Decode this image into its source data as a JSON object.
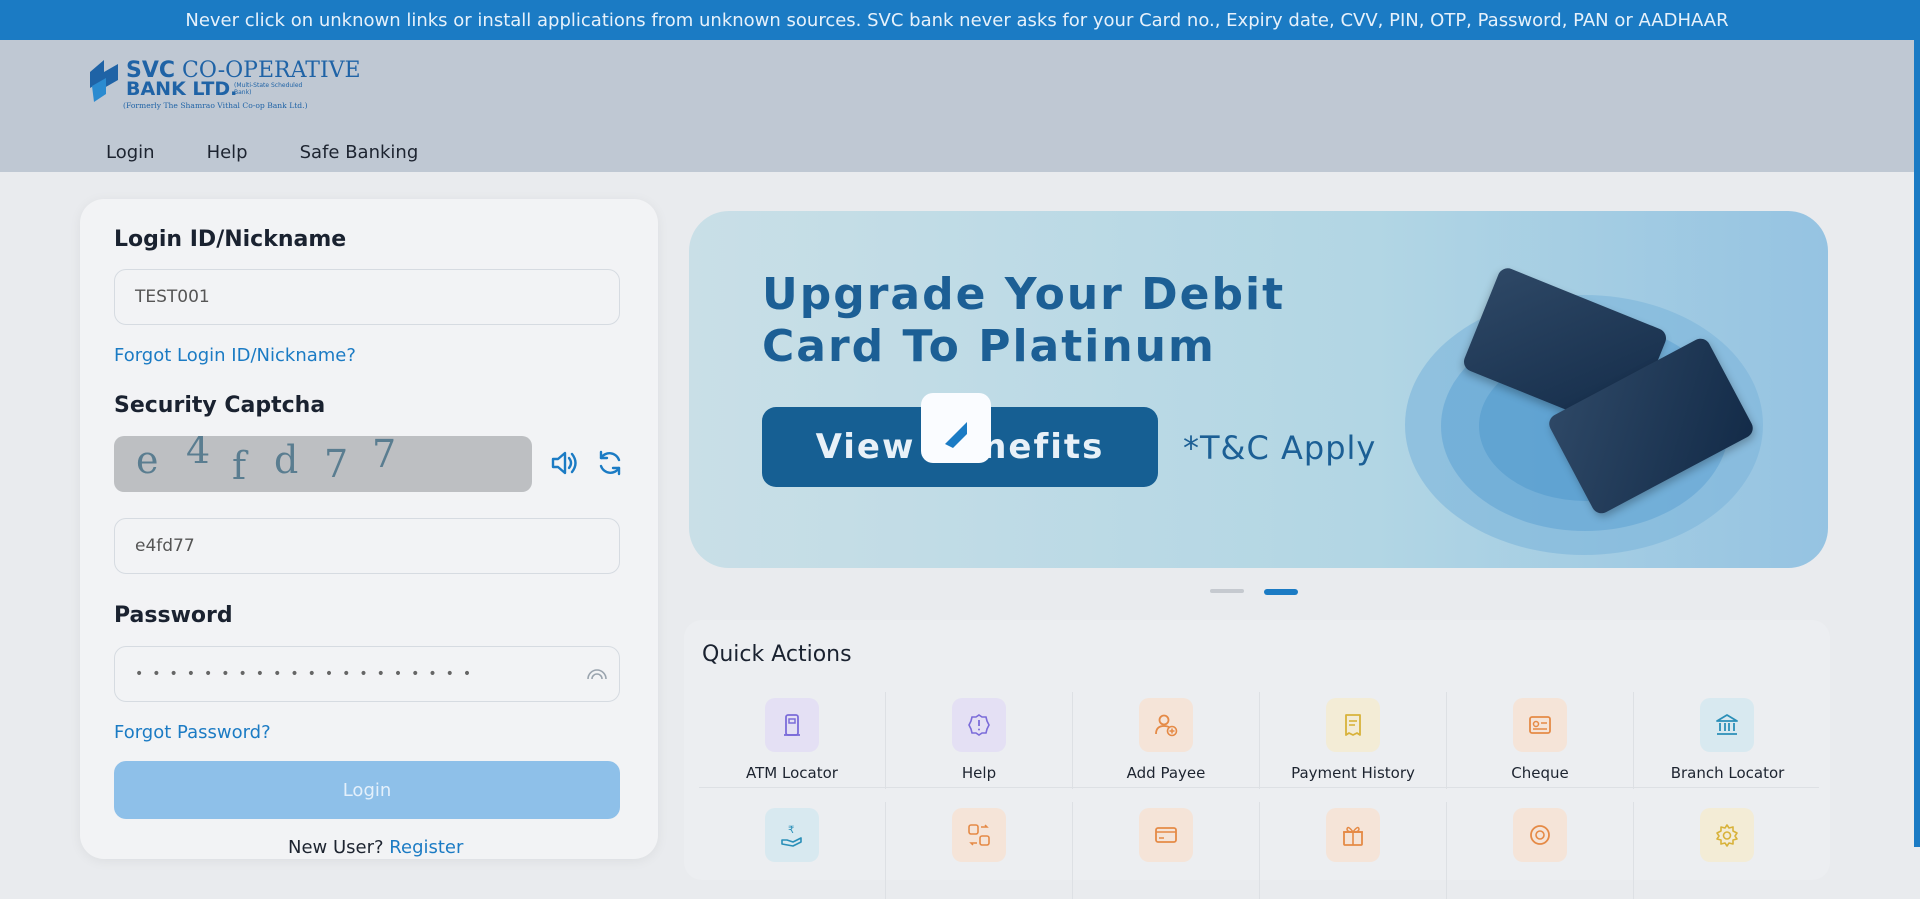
{
  "alert": {
    "text": "Never click on unknown links or install applications from unknown sources. SVC bank never asks for your Card no., Expiry date, CVV, PIN, OTP, Password, PAN or AADHAAR"
  },
  "logo": {
    "line1_bold": "SVC",
    "line1": " CO-OPERATIVE",
    "line2": "BANK LTD.",
    "tag": "(Multi-State Scheduled Bank)",
    "formerly": "(Formerly The Shamrao Vithal Co-op Bank Ltd.)"
  },
  "nav": {
    "items": [
      "Login",
      "Help",
      "Safe Banking"
    ]
  },
  "login": {
    "id_label": "Login ID/Nickname",
    "id_value": "TEST001",
    "forgot_id": "Forgot Login ID/Nickname?",
    "captcha_label": "Security Captcha",
    "captcha_chars": [
      "e",
      "4",
      "f",
      "d",
      "7",
      "7"
    ],
    "captcha_value": "e4fd77",
    "password_label": "Password",
    "password_value": "••••••••••••••••••••",
    "forgot_password": "Forgot Password?",
    "login_button": "Login",
    "new_user": "New User? ",
    "register": "Register"
  },
  "banner": {
    "line1": "Upgrade Your Debit",
    "line2": "Card To Platinum",
    "button": "View Benefits",
    "tc": "*T&C Apply",
    "active_slide": 2,
    "slide_count": 2
  },
  "quick_actions": {
    "title": "Quick Actions",
    "row1": [
      {
        "label": "ATM Locator",
        "icon": "atm-icon",
        "color": "#7b6cd9",
        "bg": "#e4e0f4"
      },
      {
        "label": "Help",
        "icon": "help-icon",
        "color": "#7b6cd9",
        "bg": "#e4e0f4"
      },
      {
        "label": "Add Payee",
        "icon": "add-payee-icon",
        "color": "#e58a46",
        "bg": "#f5e4d8"
      },
      {
        "label": "Payment History",
        "icon": "payment-history-icon",
        "color": "#d8b23a",
        "bg": "#f3ecd6"
      },
      {
        "label": "Cheque",
        "icon": "cheque-icon",
        "color": "#e58a46",
        "bg": "#f5e4d8"
      },
      {
        "label": "Branch Locator",
        "icon": "bank-icon",
        "color": "#2a8fb8",
        "bg": "#d8e9f0"
      }
    ],
    "row2": [
      {
        "icon": "rupee-hand-icon",
        "color": "#2a8fb8",
        "bg": "#d8e9f0"
      },
      {
        "icon": "transfer-icon",
        "color": "#e58a46",
        "bg": "#f5e4d8"
      },
      {
        "icon": "card-icon",
        "color": "#e58a46",
        "bg": "#f5e4d8"
      },
      {
        "icon": "gift-icon",
        "color": "#e58a46",
        "bg": "#f5e4d8"
      },
      {
        "icon": "target-icon",
        "color": "#e58a46",
        "bg": "#f5e4d8"
      },
      {
        "icon": "settings-icon",
        "color": "#d8b23a",
        "bg": "#f3ecd6"
      }
    ]
  },
  "colors": {
    "primary": "#1b7bc4",
    "header_bg": "#bfc8d3",
    "page_bg": "#e9ebee"
  }
}
